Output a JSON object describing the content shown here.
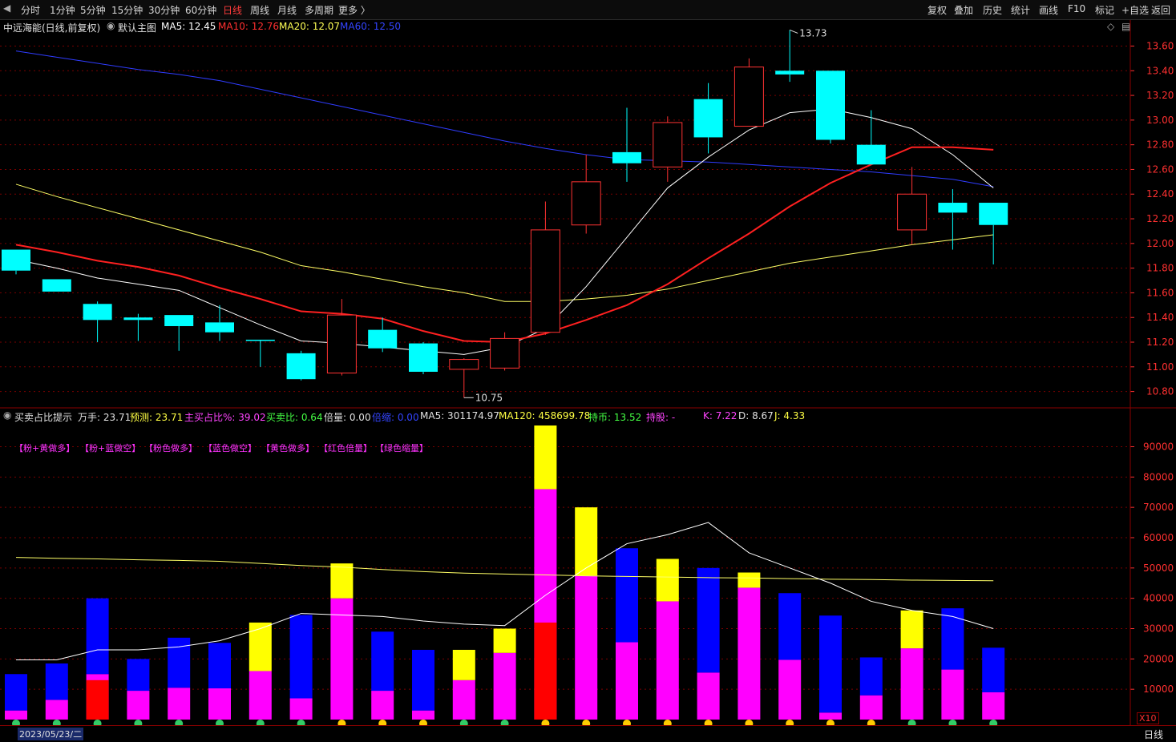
{
  "toolbar": {
    "left_items": [
      "分时",
      "1分钟",
      "5分钟",
      "15分钟",
      "30分钟",
      "60分钟",
      "日线",
      "周线",
      "月线",
      "多周期",
      "更多 〉"
    ],
    "active_item": "日线",
    "right_items": [
      "复权",
      "叠加",
      "历史",
      "统计",
      "画线",
      "F10",
      "标记",
      "+自选",
      "返回"
    ]
  },
  "main_header": {
    "stock": "中远海能(日线,前复权)",
    "template": "默认主图",
    "ma5": "MA5: 12.45",
    "ma10": "MA10: 12.76",
    "ma20": "MA20: 12.07",
    "ma60": "MA60: 12.50"
  },
  "sub_header": {
    "indicator": "买卖占比提示",
    "wanshou": "万手: 23.71",
    "yuce": "预测: 23.71",
    "zhumai": "主买占比%: 39.02",
    "maimaibi": "买卖比: 0.64",
    "beiliang": "倍量: 0.00",
    "beisuo": "倍缩: 0.00",
    "ma5": "MA5: 301174.97",
    "ma120": "MA120: 458699.78",
    "chibi": "持币: 13.52",
    "chigu": "持股: -",
    "k": "K: 7.22",
    "d": "D: 8.67",
    "j": "J: 4.33"
  },
  "legend_tags": [
    "【粉+黄做多】",
    "【粉+蓝做空】",
    "【粉色做多】",
    "【蓝色做空】",
    "【黄色做多】",
    "【红色倍量】",
    "【绿色缩量】"
  ],
  "colors": {
    "up": "#ff3232",
    "down": "#00ffff",
    "ma5": "#ffffff",
    "ma10": "#ff2020",
    "ma20": "#ffff66",
    "ma60": "#2f3cff",
    "pink": "#ff00ff",
    "blue": "#0000ff",
    "yellow": "#ffff00",
    "red": "#ff0000",
    "grid": "#7a0000",
    "axis": "#ff3030"
  },
  "chart_data": [
    {
      "type": "candlestick",
      "title": "中远海能(日线,前复权)",
      "y_ticks": [
        10.8,
        11.0,
        11.2,
        11.4,
        11.6,
        11.8,
        12.0,
        12.2,
        12.4,
        12.6,
        12.8,
        13.0,
        13.2,
        13.4,
        13.6
      ],
      "ylim": [
        10.7,
        13.72
      ],
      "candles": [
        {
          "open": 11.95,
          "high": 11.95,
          "low": 11.75,
          "close": 11.78
        },
        {
          "open": 11.71,
          "high": 11.71,
          "low": 11.61,
          "close": 11.61
        },
        {
          "open": 11.51,
          "high": 11.53,
          "low": 11.2,
          "close": 11.38
        },
        {
          "open": 11.4,
          "high": 11.43,
          "low": 11.21,
          "close": 11.38
        },
        {
          "open": 11.42,
          "high": 11.42,
          "low": 11.13,
          "close": 11.33
        },
        {
          "open": 11.36,
          "high": 11.5,
          "low": 11.21,
          "close": 11.28
        },
        {
          "open": 11.22,
          "high": 11.22,
          "low": 11.0,
          "close": 11.21
        },
        {
          "open": 11.11,
          "high": 11.13,
          "low": 10.89,
          "close": 10.9
        },
        {
          "open": 10.95,
          "high": 11.55,
          "low": 10.93,
          "close": 11.42
        },
        {
          "open": 11.3,
          "high": 11.4,
          "low": 11.12,
          "close": 11.15
        },
        {
          "open": 11.19,
          "high": 11.2,
          "low": 10.94,
          "close": 10.96
        },
        {
          "open": 10.98,
          "high": 11.07,
          "low": 10.75,
          "close": 11.06
        },
        {
          "open": 10.99,
          "high": 11.28,
          "low": 10.97,
          "close": 11.23
        },
        {
          "open": 11.28,
          "high": 12.34,
          "low": 11.26,
          "close": 12.11
        },
        {
          "open": 12.15,
          "high": 12.72,
          "low": 12.08,
          "close": 12.5
        },
        {
          "open": 12.74,
          "high": 13.1,
          "low": 12.5,
          "close": 12.65
        },
        {
          "open": 12.62,
          "high": 13.03,
          "low": 12.5,
          "close": 12.98
        },
        {
          "open": 13.17,
          "high": 13.3,
          "low": 12.73,
          "close": 12.86
        },
        {
          "open": 12.95,
          "high": 13.5,
          "low": 12.95,
          "close": 13.43
        },
        {
          "open": 13.4,
          "high": 13.73,
          "low": 13.31,
          "close": 13.37
        },
        {
          "open": 13.4,
          "high": 13.4,
          "low": 12.81,
          "close": 12.84
        },
        {
          "open": 12.8,
          "high": 13.08,
          "low": 12.64,
          "close": 12.64
        },
        {
          "open": 12.11,
          "high": 12.62,
          "low": 11.99,
          "close": 12.4
        },
        {
          "open": 12.33,
          "high": 12.44,
          "low": 11.95,
          "close": 12.25
        },
        {
          "open": 12.33,
          "high": 12.33,
          "low": 11.83,
          "close": 12.15
        }
      ],
      "ma5": [
        11.87,
        11.8,
        11.72,
        11.67,
        11.62,
        11.48,
        11.34,
        11.21,
        11.19,
        11.16,
        11.13,
        11.1,
        11.16,
        11.31,
        11.65,
        12.05,
        12.45,
        12.7,
        12.92,
        13.06,
        13.09,
        13.02,
        12.93,
        12.72,
        12.45
      ],
      "ma10": [
        11.99,
        11.93,
        11.86,
        11.81,
        11.74,
        11.64,
        11.55,
        11.45,
        11.43,
        11.39,
        11.29,
        11.21,
        11.2,
        11.27,
        11.38,
        11.5,
        11.67,
        11.88,
        12.08,
        12.3,
        12.49,
        12.64,
        12.78,
        12.78,
        12.76
      ],
      "ma20": [
        12.48,
        12.38,
        12.29,
        12.2,
        12.11,
        12.02,
        11.93,
        11.82,
        11.77,
        11.71,
        11.65,
        11.6,
        11.53,
        11.53,
        11.55,
        11.58,
        11.63,
        11.7,
        11.77,
        11.84,
        11.89,
        11.94,
        11.99,
        12.03,
        12.07
      ],
      "ma60": [
        13.56,
        13.51,
        13.46,
        13.41,
        13.37,
        13.32,
        13.25,
        13.18,
        13.11,
        13.04,
        12.97,
        12.9,
        12.83,
        12.77,
        12.72,
        12.68,
        12.67,
        12.66,
        12.64,
        12.62,
        12.6,
        12.58,
        12.55,
        12.52,
        12.46
      ],
      "high_label": "13.73",
      "low_label": "10.75"
    },
    {
      "type": "stacked-bar",
      "title": "买卖占比提示",
      "y_ticks": [
        10000,
        20000,
        30000,
        40000,
        50000,
        60000,
        70000,
        80000,
        90000
      ],
      "ylim": [
        0,
        97000
      ],
      "series": [
        {
          "name": "粉色做多",
          "values": [
            3000,
            6500,
            15000,
            9500,
            10500,
            10300,
            16000,
            7000,
            40000,
            9500,
            3000,
            13000,
            22000,
            76000,
            47500,
            25500,
            39000,
            15500,
            43500,
            19700,
            2300,
            8000,
            23500,
            16500,
            9000
          ]
        },
        {
          "name": "蓝色做空",
          "values": [
            12000,
            12000,
            25000,
            10500,
            16500,
            15000,
            0,
            27500,
            0,
            19500,
            20000,
            0,
            0,
            0,
            0,
            31000,
            0,
            34500,
            0,
            22000,
            32000,
            12500,
            0,
            20200,
            14700
          ]
        },
        {
          "name": "黄色做多",
          "values": [
            0,
            0,
            0,
            0,
            0,
            0,
            16000,
            0,
            11500,
            0,
            0,
            10000,
            8000,
            21000,
            22500,
            0,
            14000,
            0,
            5000,
            0,
            0,
            0,
            12500,
            0,
            0
          ]
        },
        {
          "name": "红色倍量",
          "values": [
            0,
            0,
            13000,
            0,
            0,
            0,
            0,
            0,
            0,
            0,
            0,
            0,
            0,
            32000,
            0,
            0,
            0,
            0,
            0,
            0,
            0,
            0,
            0,
            0,
            0
          ]
        }
      ],
      "ma5": [
        19700,
        19700,
        23000,
        23000,
        24000,
        26000,
        30000,
        35000,
        34500,
        34000,
        32500,
        31500,
        31000,
        41000,
        50000,
        58000,
        61000,
        65000,
        55000,
        50000,
        45000,
        39000,
        36000,
        34000,
        30000
      ],
      "ma120": [
        53500,
        53200,
        53000,
        52700,
        52500,
        52200,
        51500,
        50800,
        50300,
        49500,
        48800,
        48300,
        48000,
        47700,
        47400,
        47200,
        47000,
        46800,
        46700,
        46500,
        46300,
        46200,
        46000,
        45900,
        45800
      ],
      "marker_colors": [
        "green",
        "green",
        "green",
        "green",
        "green",
        "green",
        "green",
        "green",
        "yellow",
        "yellow",
        "yellow",
        "green",
        "green",
        "yellow",
        "yellow",
        "yellow",
        "yellow",
        "yellow",
        "yellow",
        "yellow",
        "yellow",
        "yellow",
        "green",
        "green",
        "green"
      ]
    }
  ],
  "status": {
    "date": "2023/05/23/二",
    "multiplier": "X10",
    "period": "日线"
  }
}
